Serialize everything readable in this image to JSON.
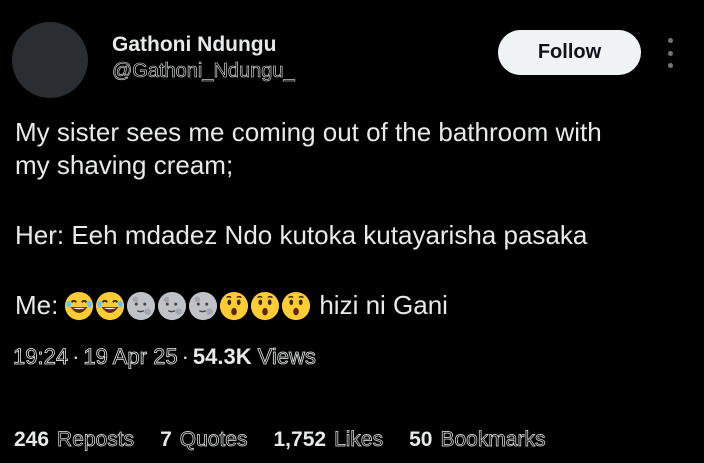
{
  "author": {
    "display_name": "Gathoni Ndungu",
    "handle": "@Gathoni_Ndungu_"
  },
  "actions": {
    "follow_label": "Follow",
    "more_icon": "more-vertical-icon"
  },
  "tweet": {
    "line1": "My sister sees me coming out of the bathroom with",
    "line2": "my shaving cream;",
    "line3": "Her: Eeh mdadez Ndo kutoka kutayarisha pasaka",
    "me_prefix": "Me:",
    "emojis": [
      "laughing-face",
      "laughing-face",
      "moon-face",
      "moon-face",
      "moon-face",
      "hushed-face",
      "hushed-face",
      "hushed-face"
    ],
    "me_suffix": "hizi ni Gani"
  },
  "meta": {
    "time": "19:24",
    "date": "19 Apr 25",
    "views_count": "54.3K",
    "views_label": "Views"
  },
  "stats": {
    "reposts_count": "246",
    "reposts_label": "Reposts",
    "quotes_count": "7",
    "quotes_label": "Quotes",
    "likes_count": "1,752",
    "likes_label": "Likes",
    "bookmarks_count": "50",
    "bookmarks_label": "Bookmarks"
  },
  "colors": {
    "background": "#000000",
    "text": "#e7e9ea",
    "muted": "#71767b",
    "follow_bg": "#eff3f4",
    "emoji_yellow": "#ffcc33",
    "emoji_moon": "#bfc3c8"
  }
}
